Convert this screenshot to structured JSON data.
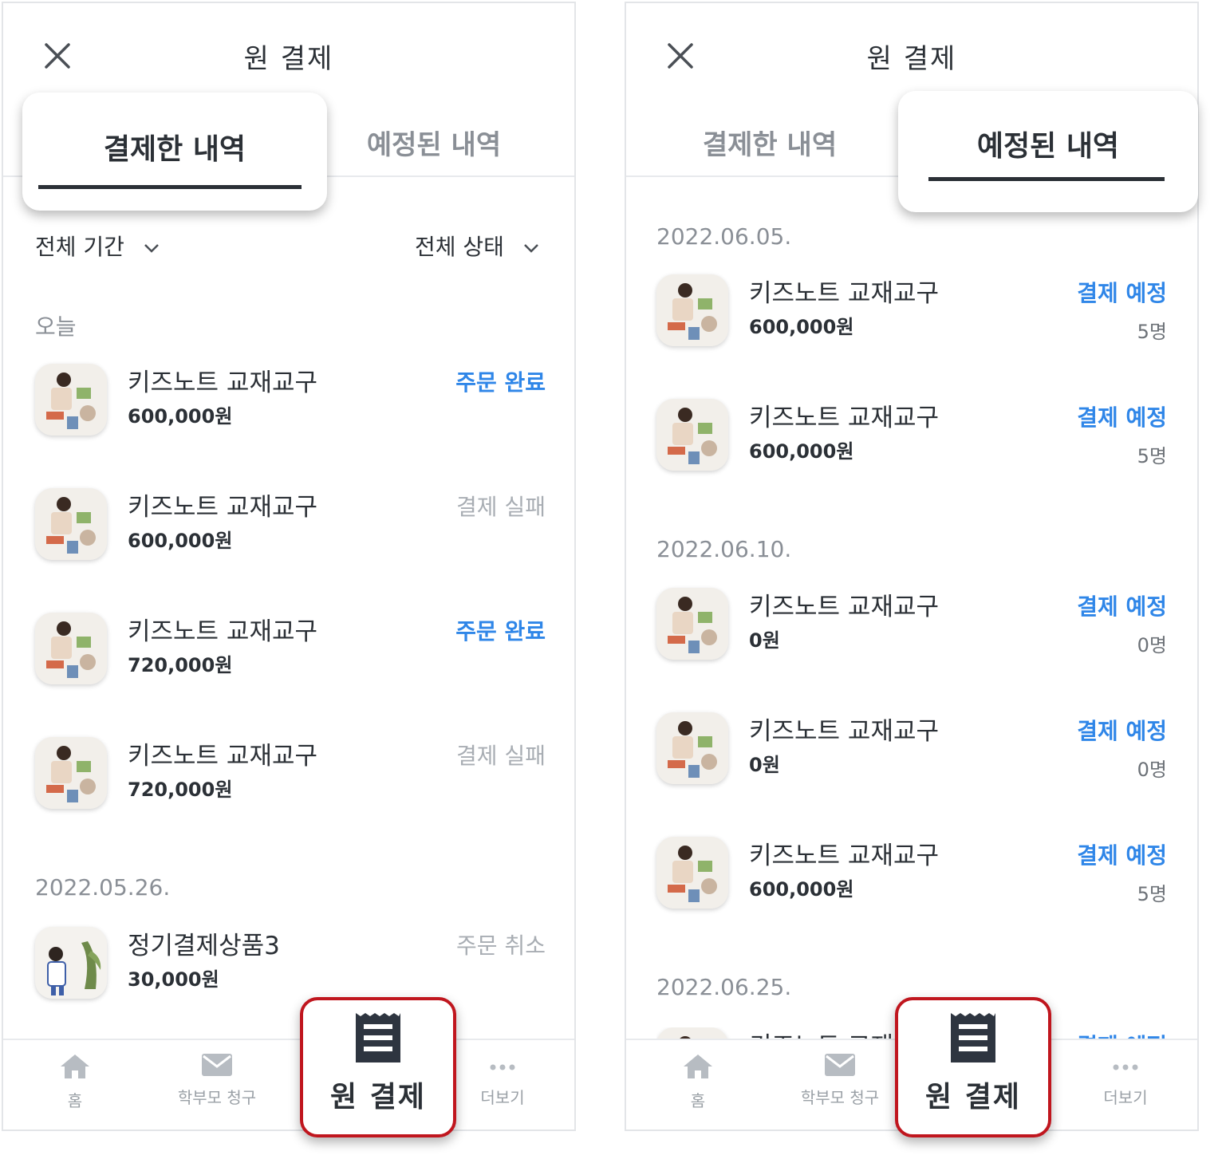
{
  "left": {
    "header": {
      "title": "원 결제"
    },
    "tabs": {
      "paid": "결제한 내역",
      "scheduled": "예정된 내역"
    },
    "filters": {
      "period": "전체 기간",
      "status": "전체 상태"
    },
    "groups": [
      {
        "date": "오늘",
        "items": [
          {
            "title": "키즈노트 교재교구",
            "price": "600,000원",
            "status": "주문 완료",
            "status_type": "blue"
          },
          {
            "title": "키즈노트 교재교구",
            "price": "600,000원",
            "status": "결제 실패",
            "status_type": "grey"
          },
          {
            "title": "키즈노트 교재교구",
            "price": "720,000원",
            "status": "주문 완료",
            "status_type": "blue"
          },
          {
            "title": "키즈노트 교재교구",
            "price": "720,000원",
            "status": "결제 실패",
            "status_type": "grey"
          }
        ]
      },
      {
        "date": "2022.05.26.",
        "items": [
          {
            "title": "정기결제상품3",
            "price": "30,000원",
            "status": "주문 취소",
            "status_type": "grey"
          }
        ]
      }
    ]
  },
  "right": {
    "header": {
      "title": "원 결제"
    },
    "tabs": {
      "paid": "결제한 내역",
      "scheduled": "예정된 내역"
    },
    "groups": [
      {
        "date": "2022.06.05.",
        "items": [
          {
            "title": "키즈노트 교재교구",
            "price": "600,000원",
            "status": "결제 예정",
            "count": "5명"
          },
          {
            "title": "키즈노트 교재교구",
            "price": "600,000원",
            "status": "결제 예정",
            "count": "5명"
          }
        ]
      },
      {
        "date": "2022.06.10.",
        "items": [
          {
            "title": "키즈노트 교재교구",
            "price": "0원",
            "status": "결제 예정",
            "count": "0명"
          },
          {
            "title": "키즈노트 교재교구",
            "price": "0원",
            "status": "결제 예정",
            "count": "0명"
          },
          {
            "title": "키즈노트 교재교구",
            "price": "600,000원",
            "status": "결제 예정",
            "count": "5명"
          }
        ]
      },
      {
        "date": "2022.06.25.",
        "items": [
          {
            "title": "키즈노트 교재교구",
            "status": "결제 예정"
          }
        ]
      }
    ]
  },
  "nav": {
    "home": "홈",
    "parent_bill": "학부모 청구",
    "payment": "원 결제",
    "more": "더보기"
  },
  "icons": {
    "close": "close-icon",
    "chevron": "chevron-down-icon",
    "home": "home-icon",
    "mail": "mail-icon",
    "receipt": "receipt-icon",
    "more": "more-dots-icon"
  },
  "colors": {
    "accent_blue": "#2f86e8",
    "status_grey": "#a8adb3",
    "callout_red": "#c0161e",
    "text_dark": "#2b3036"
  }
}
